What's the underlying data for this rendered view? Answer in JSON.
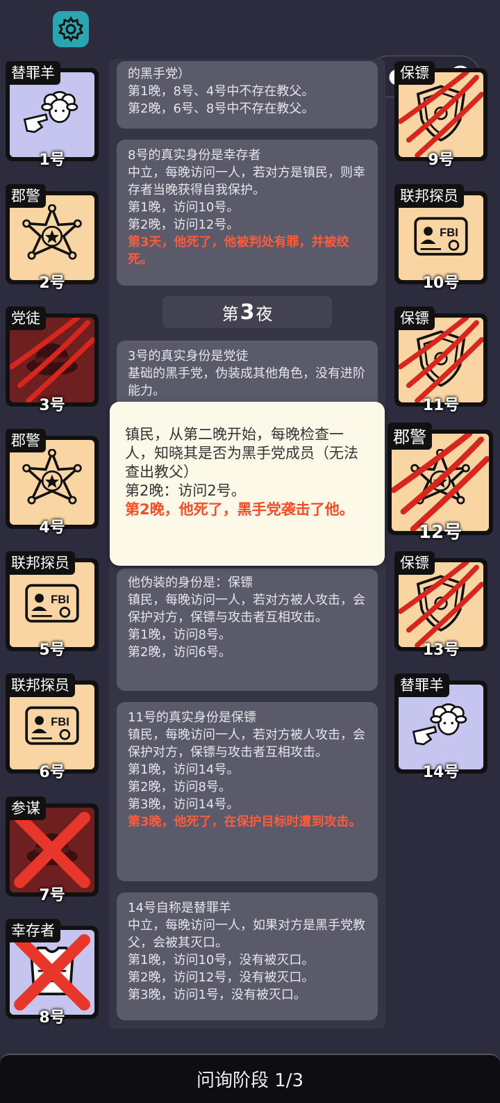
{
  "topbar": {
    "settings_icon": "gear-icon",
    "menu_icon": "dots-icon",
    "target_icon": "target-icon"
  },
  "night_header": {
    "prefix": "第",
    "number": "3",
    "suffix": "夜"
  },
  "logs": [
    {
      "lines": [
        "的黑手党）",
        "第1晚，8号、4号中不存在教父。",
        "第2晚，6号、8号中不存在教父。"
      ],
      "red": []
    },
    {
      "lines": [
        "8号的真实身份是幸存者",
        "中立，每晚访问一人，若对方是镇民，则幸存者当晚获得自我保护。",
        "第1晚，访问10号。",
        "第2晚，访问12号。"
      ],
      "red": [
        "第3天，他死了，他被判处有罪，并被绞死。"
      ]
    },
    {
      "lines": [
        "3号的真实身份是党徒",
        "基础的黑手党，伪装成其他角色，没有进阶能力。"
      ],
      "red": []
    },
    {
      "lines": [
        "他伪装的身份是：保镖",
        "镇民，每晚访问一人，若对方被人攻击，会保护对方，保镖与攻击者互相攻击。",
        "第1晚，访问8号。",
        "第2晚，访问6号。"
      ],
      "red": []
    },
    {
      "lines": [
        "11号的真实身份是保镖",
        "镇民，每晚访问一人，若对方被人攻击，会保护对方，保镖与攻击者互相攻击。",
        "第1晚，访问14号。",
        "第2晚，访问8号。",
        "第3晚，访问14号。"
      ],
      "red": [
        "第3晚，他死了，在保护目标时遭到攻击。"
      ]
    },
    {
      "lines": [
        "14号自称是替罪羊",
        "中立，每晚访问一人，如果对方是黑手党教父，会被其灭口。",
        "第1晚，访问10号，没有被灭口。",
        "第2晚，访问12号，没有被灭口。",
        "第3晚，访问1号，没有被灭口。"
      ],
      "red": []
    }
  ],
  "popup": {
    "lines": [
      "镇民，从第二晚开始，每晚检查一人，知晓其是否为黑手党成员（无法查出教父）",
      "第2晚：访问2号。"
    ],
    "red": "第2晚，他死了，黑手党袭击了他。"
  },
  "players_left": [
    {
      "role": "替罪羊",
      "num": "1号",
      "icon": "sheep-icon",
      "bg": "lav",
      "status": "alive"
    },
    {
      "role": "郡警",
      "num": "2号",
      "icon": "sheriff-badge-icon",
      "bg": "peach",
      "status": "alive"
    },
    {
      "role": "党徒",
      "num": "3号",
      "icon": "mafia-hat-icon",
      "bg": "dark",
      "status": "dead"
    },
    {
      "role": "郡警",
      "num": "4号",
      "icon": "sheriff-badge-icon",
      "bg": "peach",
      "status": "alive"
    },
    {
      "role": "联邦探员",
      "num": "5号",
      "icon": "fbi-card-icon",
      "bg": "peach",
      "status": "alive"
    },
    {
      "role": "联邦探员",
      "num": "6号",
      "icon": "fbi-card-icon",
      "bg": "peach",
      "status": "alive"
    },
    {
      "role": "参谋",
      "num": "7号",
      "icon": "mafia-hat-icon",
      "bg": "dark",
      "status": "crossed"
    },
    {
      "role": "幸存者",
      "num": "8号",
      "icon": "vest-icon",
      "bg": "lav",
      "status": "crossed"
    }
  ],
  "players_right": [
    {
      "role": "保镖",
      "num": "9号",
      "icon": "shield-icon",
      "bg": "peach",
      "status": "dead"
    },
    {
      "role": "联邦探员",
      "num": "10号",
      "icon": "fbi-card-icon",
      "bg": "peach",
      "status": "alive"
    },
    {
      "role": "保镖",
      "num": "11号",
      "icon": "shield-icon",
      "bg": "peach",
      "status": "dead"
    },
    {
      "role": "郡警",
      "num": "12号",
      "icon": "sheriff-badge-icon",
      "bg": "peach",
      "status": "dead"
    },
    {
      "role": "保镖",
      "num": "13号",
      "icon": "shield-icon",
      "bg": "peach",
      "status": "dead"
    },
    {
      "role": "替罪羊",
      "num": "14号",
      "icon": "sheep-icon",
      "bg": "lav",
      "status": "alive"
    }
  ],
  "bottombar": {
    "label": "问询阶段 1/3"
  },
  "colors": {
    "background": "#2d2c3e",
    "death_text": "#ff5a3a",
    "claw": "#d8261e",
    "popup_bg": "#fcf9e9"
  }
}
